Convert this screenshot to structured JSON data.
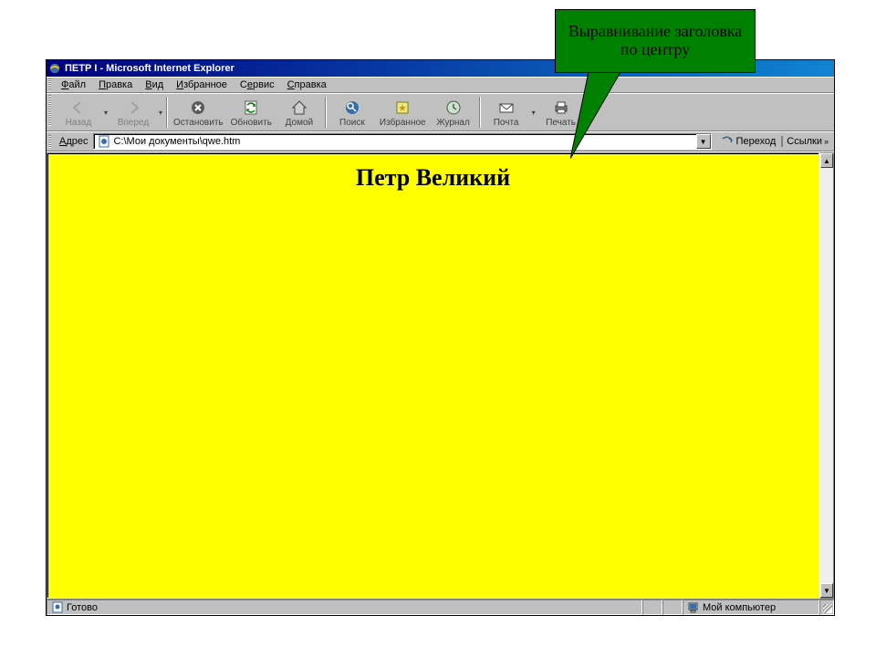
{
  "window": {
    "title": "ПЕТР I - Microsoft Internet Explorer"
  },
  "menubar": {
    "items": [
      {
        "label": "Файл",
        "ul": "Ф"
      },
      {
        "label": "Правка",
        "ul": "П"
      },
      {
        "label": "Вид",
        "ul": "В"
      },
      {
        "label": "Избранное",
        "ul": "И"
      },
      {
        "label": "Сервис",
        "ul": "С"
      },
      {
        "label": "Справка",
        "ul": "С"
      }
    ]
  },
  "toolbar": {
    "back": "Назад",
    "forward": "Вперед",
    "stop": "Остановить",
    "refresh": "Обновить",
    "home": "Домой",
    "search": "Поиск",
    "favorites": "Избранное",
    "history": "Журнал",
    "mail": "Почта",
    "print": "Печать"
  },
  "addressbar": {
    "label": "Адрес",
    "value": "C:\\Мои документы\\qwe.htm",
    "go": "Переход",
    "links": "Ссылки"
  },
  "page": {
    "heading": "Петр Великий"
  },
  "statusbar": {
    "ready": "Готово",
    "zone": "Мой компьютер"
  },
  "callout": {
    "text": "Выравнивание заголовка по центру"
  }
}
